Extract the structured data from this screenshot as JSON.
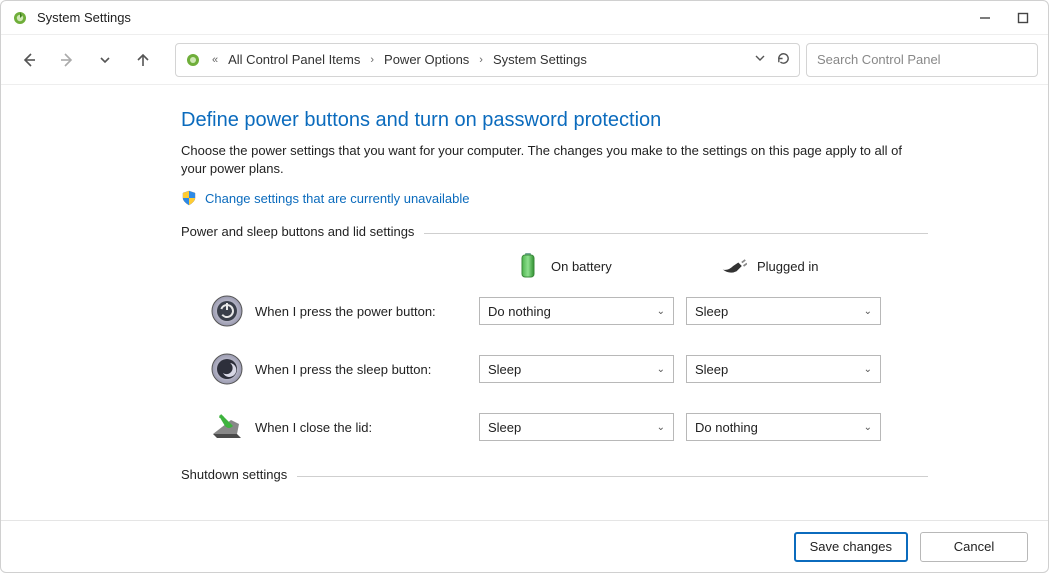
{
  "window": {
    "title": "System Settings"
  },
  "breadcrumb": {
    "item1": "All Control Panel Items",
    "item2": "Power Options",
    "item3": "System Settings"
  },
  "search": {
    "placeholder": "Search Control Panel"
  },
  "page": {
    "heading": "Define power buttons and turn on password protection",
    "description": "Choose the power settings that you want for your computer. The changes you make to the settings on this page apply to all of your power plans.",
    "change_link": "Change settings that are currently unavailable"
  },
  "group1": {
    "label": "Power and sleep buttons and lid settings",
    "col_battery": "On battery",
    "col_plugged": "Plugged in",
    "row_power": {
      "label": "When I press the power button:",
      "battery": "Do nothing",
      "plugged": "Sleep"
    },
    "row_sleep": {
      "label": "When I press the sleep button:",
      "battery": "Sleep",
      "plugged": "Sleep"
    },
    "row_lid": {
      "label": "When I close the lid:",
      "battery": "Sleep",
      "plugged": "Do nothing"
    }
  },
  "group2": {
    "label": "Shutdown settings"
  },
  "footer": {
    "save": "Save changes",
    "cancel": "Cancel"
  }
}
